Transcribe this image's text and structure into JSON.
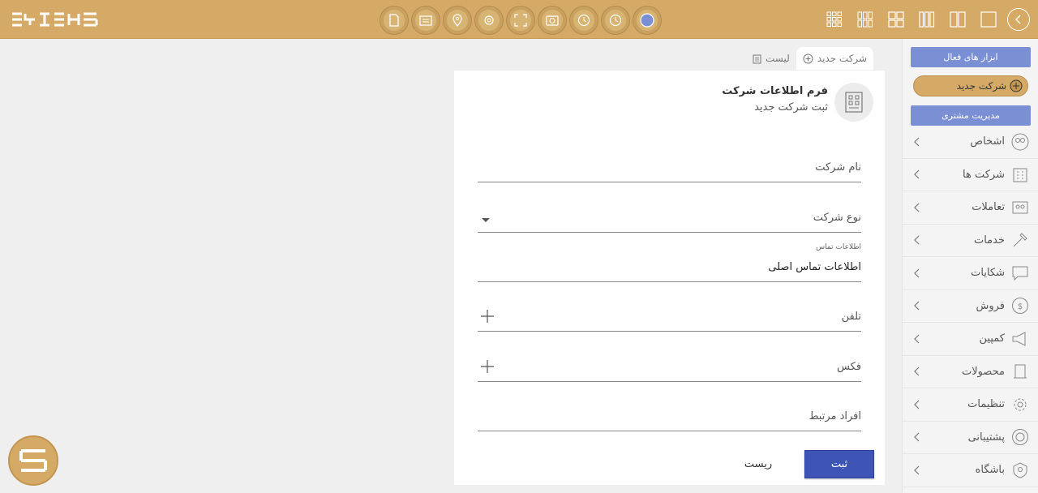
{
  "colors": {
    "topbar": "#d4aa66",
    "accent_blue": "#7b8fd5",
    "submit": "#3e55b5"
  },
  "topbar": {
    "tools": [
      "file-icon",
      "calendar-icon",
      "location-pin-icon",
      "gear-outline-icon",
      "scan-icon",
      "camera-icon",
      "clock-icon",
      "clock-icon",
      "circle-icon"
    ],
    "layouts": [
      "grid-3x3-icon",
      "grid-3x2-icon",
      "grid-2x2-icon",
      "columns-3-icon",
      "columns-2-icon",
      "single-pane-icon"
    ]
  },
  "sidebar": {
    "active_tools": "ابزار های فعال",
    "new_company": "شرکت جدید",
    "customer_mgmt": "مدیریت مشتری",
    "items": [
      {
        "label": "اشخاص",
        "icon": "people-icon"
      },
      {
        "label": "شرکت ها",
        "icon": "building-icon"
      },
      {
        "label": "تعاملات",
        "icon": "interaction-icon"
      },
      {
        "label": "خدمات",
        "icon": "hammer-icon"
      },
      {
        "label": "شکایات",
        "icon": "comment-icon"
      },
      {
        "label": "فروش",
        "icon": "dollar-icon"
      },
      {
        "label": "کمپین",
        "icon": "megaphone-icon"
      },
      {
        "label": "محصولات",
        "icon": "box-icon"
      },
      {
        "label": "تنظیمات",
        "icon": "settings-icon"
      },
      {
        "label": "پشتیبانی",
        "icon": "support-icon"
      },
      {
        "label": "باشگاه",
        "icon": "club-icon"
      }
    ]
  },
  "tabs": {
    "new_company": "شرکت جدید",
    "list": "لیست"
  },
  "form": {
    "title": "فرم اطلاعات شرکت",
    "subtitle": "ثبت شرکت جدید",
    "company_name": "نام شرکت",
    "company_type": "نوع شرکت",
    "contact_label": "اطلاعات تماس",
    "contact_value": "اطلاعات تماس اصلی",
    "phone": "تلفن",
    "fax": "فکس",
    "related_people": "افراد مرتبط",
    "submit": "ثبت",
    "reset": "ریست"
  }
}
